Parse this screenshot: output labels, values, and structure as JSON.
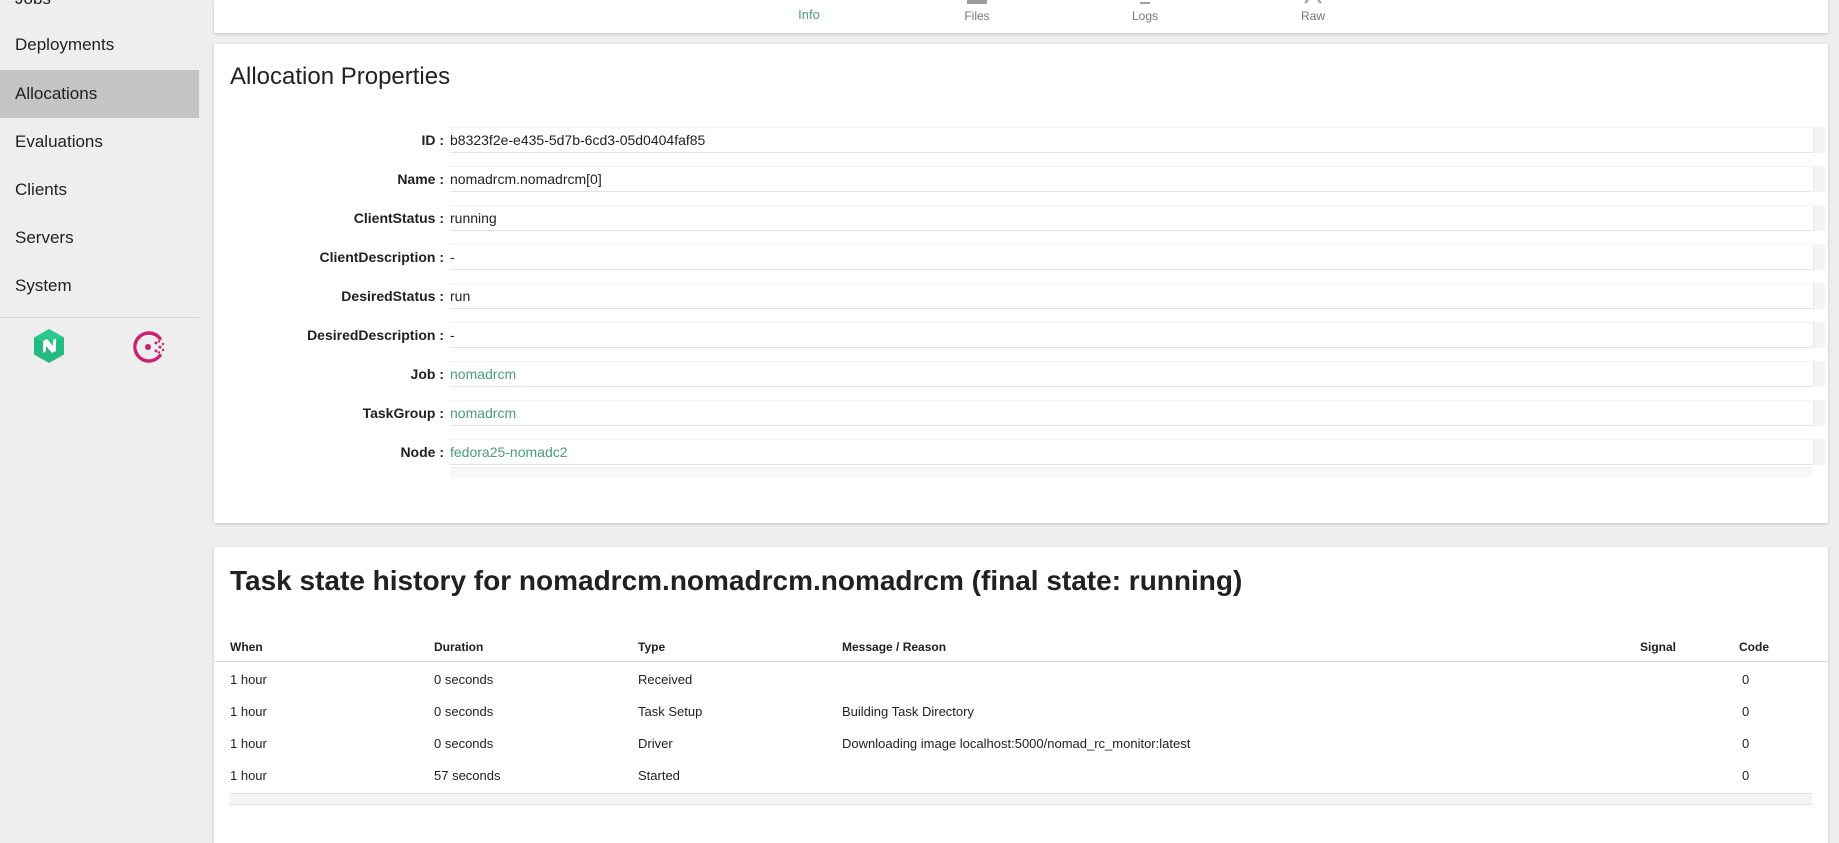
{
  "sidebar": {
    "partial_item": "Jobs",
    "items": [
      {
        "label": "Deployments"
      },
      {
        "label": "Allocations"
      },
      {
        "label": "Evaluations"
      },
      {
        "label": "Clients"
      },
      {
        "label": "Servers"
      },
      {
        "label": "System"
      }
    ],
    "active": "Allocations"
  },
  "tabs": [
    {
      "label": "Info",
      "icon": "info-icon"
    },
    {
      "label": "Files",
      "icon": "files-icon"
    },
    {
      "label": "Logs",
      "icon": "logs-icon"
    },
    {
      "label": "Raw",
      "icon": "code-icon"
    }
  ],
  "active_tab": "Info",
  "properties": {
    "title": "Allocation Properties",
    "rows": [
      {
        "label": "ID :",
        "value": "b8323f2e-e435-5d7b-6cd3-05d0404faf85"
      },
      {
        "label": "Name :",
        "value": "nomadrcm.nomadrcm[0]"
      },
      {
        "label": "ClientStatus :",
        "value": "running"
      },
      {
        "label": "ClientDescription :",
        "value": "-"
      },
      {
        "label": "DesiredStatus :",
        "value": "run"
      },
      {
        "label": "DesiredDescription :",
        "value": "-"
      },
      {
        "label": "Job :",
        "value": "nomadrcm"
      },
      {
        "label": "TaskGroup :",
        "value": "nomadrcm"
      },
      {
        "label": "Node :",
        "value": "fedora25-nomadc2"
      }
    ]
  },
  "history": {
    "title": "Task state history for nomadrcm.nomadrcm.nomadrcm (final state: running)",
    "columns": [
      "When",
      "Duration",
      "Type",
      "Message / Reason",
      "Signal",
      "Code"
    ],
    "rows": [
      {
        "when": "1 hour",
        "duration": "0 seconds",
        "type": "Received",
        "message": "",
        "signal": "",
        "code": "0"
      },
      {
        "when": "1 hour",
        "duration": "0 seconds",
        "type": "Task Setup",
        "message": "Building Task Directory",
        "signal": "",
        "code": "0"
      },
      {
        "when": "1 hour",
        "duration": "0 seconds",
        "type": "Driver",
        "message": "Downloading image localhost:5000/nomad_rc_monitor:latest",
        "signal": "",
        "code": "0"
      },
      {
        "when": "1 hour",
        "duration": "57 seconds",
        "type": "Started",
        "message": "",
        "signal": "",
        "code": "0"
      }
    ]
  },
  "colors": {
    "accent": "#4a9c7f",
    "nomad_brand": "#25ba81",
    "consul_brand": "#ca2171",
    "sidebar_active": "#c4c4c4"
  }
}
